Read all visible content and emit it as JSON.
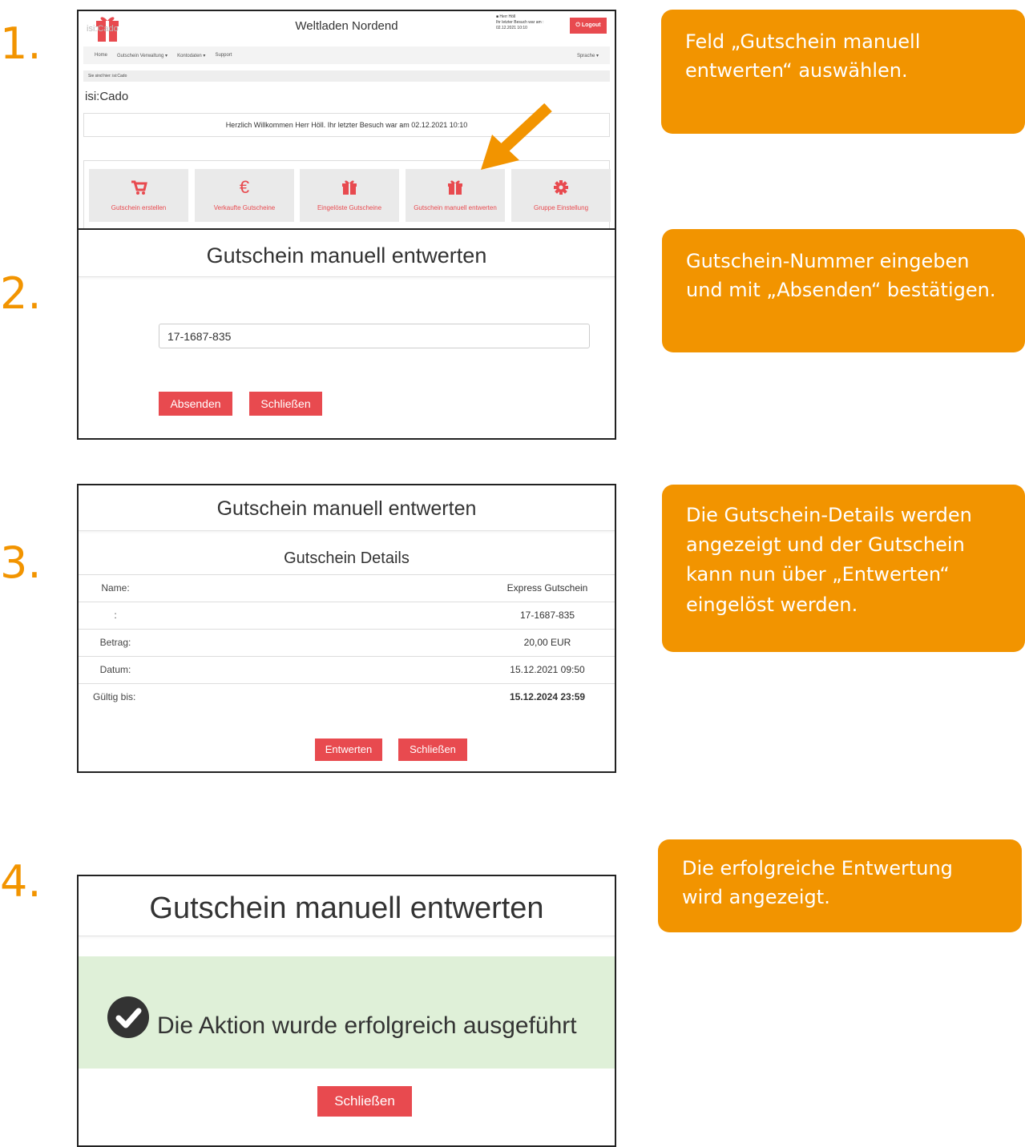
{
  "steps": {
    "one": {
      "number": "1.",
      "instruction": "Feld „Gutschein manuell entwerten“ auswählen."
    },
    "two": {
      "number": "2.",
      "instruction": "Gutschein-Nummer eingeben und mit „Absenden“ bestätigen."
    },
    "three": {
      "number": "3.",
      "instruction": "Die Gutschein-Details werden angezeigt und der Gutschein kann nun über „Entwerten“ eingelöst werden."
    },
    "four": {
      "number": "4.",
      "instruction": "Die erfolgreiche Entwertung wird angezeigt."
    }
  },
  "accent_color": "#f29400",
  "button_color": "#e84a4f",
  "app": {
    "logo_text": "isi:Cado",
    "shop_title": "Weltladen Nordend",
    "user_name": "Herr Höll",
    "last_visit_label": "Ihr letzter Besuch war am :",
    "last_visit_date": "02.12.2021 10:10",
    "logout_label": "Logout",
    "nav": {
      "home": "Home",
      "voucher_admin": "Gutschein Verwaltung ▾",
      "account": "Kontodaten ▾",
      "support": "Support",
      "language": "Sprache ▾"
    },
    "breadcrumb": "Sie sind hier: isi:Cado",
    "page_title": "isi:Cado",
    "welcome": "Herzlich Willkommen Herr Höll. Ihr letzter Besuch war am 02.12.2021 10:10",
    "tiles": [
      {
        "label": "Gutschein erstellen",
        "icon": "cart-icon"
      },
      {
        "label": "Verkaufte Gutscheine",
        "icon": "euro-icon"
      },
      {
        "label": "Eingelöste Gutscheine",
        "icon": "gift-icon"
      },
      {
        "label": "Gutschein manuell entwerten",
        "icon": "gift-icon"
      },
      {
        "label": "Gruppe Einstellung",
        "icon": "gear-icon"
      }
    ]
  },
  "modal_title": "Gutschein manuell entwerten",
  "form": {
    "voucher_number": "17-1687-835",
    "submit_label": "Absenden",
    "close_label": "Schließen"
  },
  "details": {
    "title": "Gutschein Details",
    "rows": [
      {
        "key": "Name:",
        "value": "Express Gutschein"
      },
      {
        "key": ":",
        "value": "17-1687-835"
      },
      {
        "key": "Betrag:",
        "value": "20,00 EUR"
      },
      {
        "key": "Datum:",
        "value": "15.12.2021 09:50"
      },
      {
        "key": "Gültig bis:",
        "value": "15.12.2024 23:59"
      }
    ],
    "redeem_label": "Entwerten",
    "close_label": "Schließen"
  },
  "success": {
    "message": "Die Aktion wurde erfolgreich ausgeführt",
    "close_label": "Schließen"
  }
}
